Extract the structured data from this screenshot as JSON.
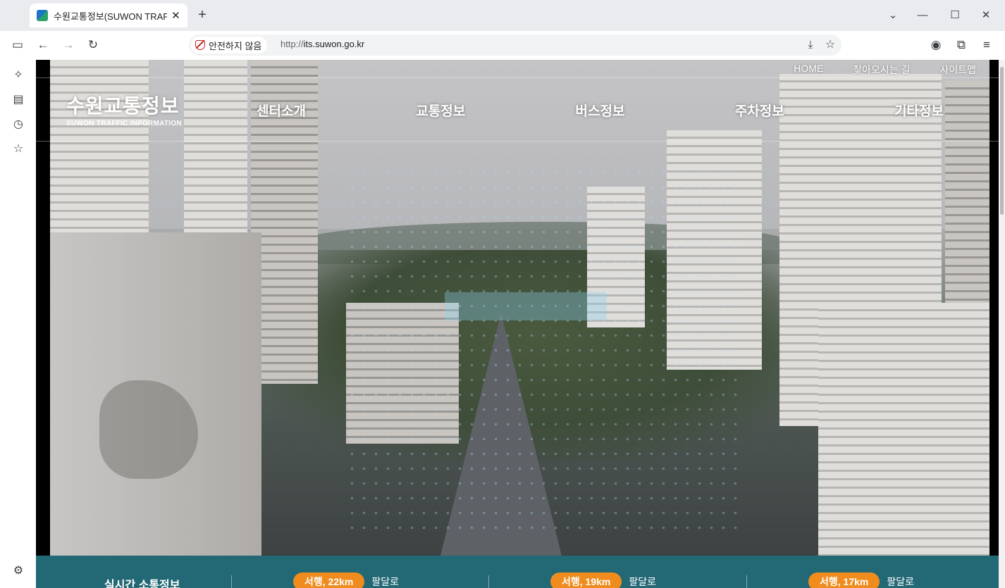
{
  "browser": {
    "tab_title": "수원교통정보(SUWON TRAFFIC",
    "tab_close": "✕",
    "new_tab": "+",
    "security_label": "안전하지 않음",
    "url_scheme": "http://",
    "url_host": "its.suwon.go.kr"
  },
  "site": {
    "utility_nav": [
      "HOME",
      "찾아오시는 길",
      "사이트맵"
    ],
    "logo_ko": "수원교통정보",
    "logo_en": "SUWON TRAFFIC INFORMATION",
    "main_nav": [
      "센터소개",
      "교통정보",
      "버스정보",
      "주차정보",
      "기타정보"
    ]
  },
  "traffic": {
    "title": "실시간 소통정보",
    "items": [
      {
        "direction": "서행, 22km",
        "road": "팔달로"
      },
      {
        "direction": "서행, 19km",
        "road": "팔달로"
      },
      {
        "direction": "서행, 17km",
        "road": "팔달로"
      }
    ]
  },
  "colors": {
    "status_bar": "#226875",
    "pill": "#f08c1e"
  }
}
